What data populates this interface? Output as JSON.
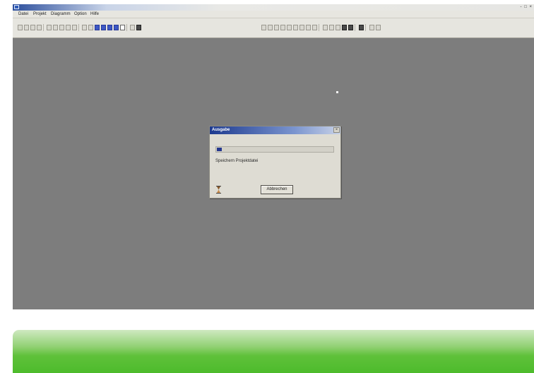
{
  "window": {
    "title": ""
  },
  "menu": {
    "items": [
      "Datei",
      "Projekt",
      "Diagramm",
      "Option",
      "Hilfe"
    ]
  },
  "toolbar": {
    "left_buttons": [
      "new-file-icon",
      "open-file-icon",
      "folder-icon",
      "arrow-icon",
      "undo-icon",
      "redo-icon",
      "cut-icon",
      "copy-icon",
      "paste-icon",
      "filter-icon",
      "check-icon",
      "blue-view-icon",
      "blue-view-icon",
      "blue-view-icon",
      "blue-view-icon",
      "doc-icon",
      "hat-icon",
      "print-icon"
    ],
    "right_buttons": [
      "grid-icon",
      "grid-icon",
      "grid-icon",
      "grid-icon",
      "grid-icon",
      "grid-icon",
      "grid-icon",
      "grid-icon",
      "grid-icon",
      "arrow-right-icon",
      "sum-icon",
      "table-icon",
      "box-icon",
      "box-icon",
      "binoculars-icon",
      "zoom-icon",
      "zoom-icon"
    ]
  },
  "dialog": {
    "title": "Ausgabe",
    "progress": 0.04,
    "message": "Speichern Projektdatei",
    "cancel_label": "Abbrechen",
    "close_glyph": "×"
  },
  "colors": {
    "desktop": "#7d7d7d",
    "dialog_title": "#1d3a8f",
    "progress_fill": "#25388f",
    "footer_green": "#4dbb2c"
  }
}
